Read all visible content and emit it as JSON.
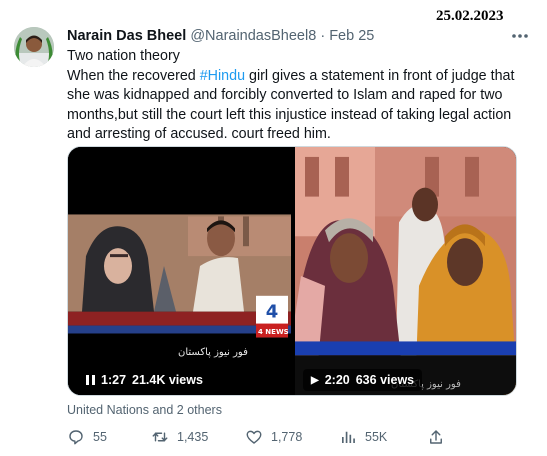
{
  "date_stamp": "25.02.2023",
  "tweet": {
    "display_name": "Narain Das Bheel",
    "handle": "@NaraindasBheel8",
    "separator": "·",
    "time": "Feb 25",
    "line1": "Two nation theory",
    "text_before_hashtag": "When the recovered ",
    "hashtag": "#Hindu",
    "text_after_hashtag": " girl gives a statement in front of judge that she was kidnapped and forcibly converted to Islam and raped for two months,but still the court left this injustice instead of taking legal action and arresting of accused. court freed him."
  },
  "media": {
    "video1": {
      "state": "paused",
      "time": "1:27",
      "views": "21.4K views",
      "channel_logo": "4 NEWS",
      "channel_text": "فور نیوز پاکستان"
    },
    "video2": {
      "state": "playing",
      "time": "2:20",
      "views": "636 views",
      "channel_text": "فور نیوز پاکستان"
    }
  },
  "mentions": "United Nations and 2 others",
  "actions": {
    "replies": "55",
    "retweets": "1,435",
    "likes": "1,778",
    "views": "55K"
  },
  "colors": {
    "accent": "#1d9bf0",
    "muted": "#536471",
    "text": "#0f1419"
  },
  "icons": [
    "more-icon",
    "reply-icon",
    "retweet-icon",
    "like-icon",
    "views-icon",
    "share-icon",
    "pause-icon",
    "play-icon"
  ]
}
